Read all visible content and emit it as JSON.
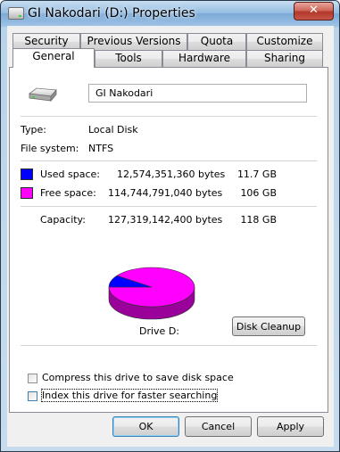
{
  "window": {
    "title": "GI Nakodari (D:) Properties",
    "close_label": "✕"
  },
  "tabs": [
    {
      "label": "Security"
    },
    {
      "label": "Previous Versions"
    },
    {
      "label": "Quota"
    },
    {
      "label": "Customize"
    },
    {
      "label": "General",
      "active": true
    },
    {
      "label": "Tools"
    },
    {
      "label": "Hardware"
    },
    {
      "label": "Sharing"
    }
  ],
  "general": {
    "name_value": "GI Nakodari",
    "type_label": "Type:",
    "type_value": "Local Disk",
    "fs_label": "File system:",
    "fs_value": "NTFS",
    "used": {
      "label": "Used space:",
      "bytes": "12,574,351,360 bytes",
      "size": "11.7 GB",
      "color": "#0000ff"
    },
    "free": {
      "label": "Free space:",
      "bytes": "114,744,791,040 bytes",
      "size": "106 GB",
      "color": "#ff00ff"
    },
    "capacity": {
      "label": "Capacity:",
      "bytes": "127,319,142,400 bytes",
      "size": "118 GB"
    },
    "drive_label": "Drive D:",
    "disk_cleanup_label": "Disk Cleanup",
    "compress_label": "Compress this drive to save disk space",
    "index_label": "Index this drive for faster searching"
  },
  "pie": {
    "used_fraction": 0.0988
  },
  "buttons": {
    "ok": "OK",
    "cancel": "Cancel",
    "apply": "Apply"
  }
}
